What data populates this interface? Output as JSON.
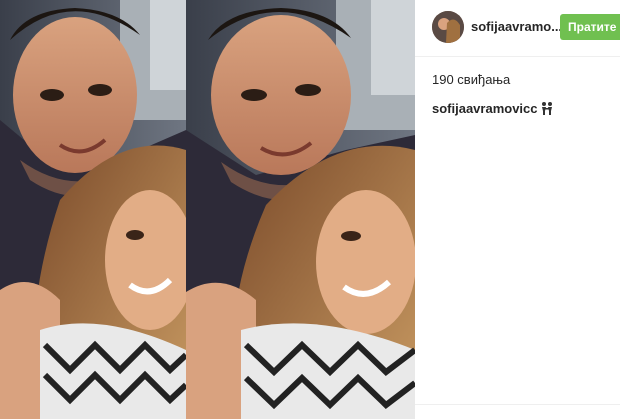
{
  "post": {
    "author": {
      "username_truncated": "sofijaavramo...",
      "avatar_icon": "profile-avatar"
    },
    "follow_label": "Пратите",
    "likes": "190 свиђања",
    "caption": {
      "author": "sofijaavramovicc",
      "emoji_icon": "couple-holding-hands-icon"
    },
    "image": {
      "description_icon": "selfie-photo"
    }
  },
  "colors": {
    "follow_button": "#70c050",
    "text": "#262626",
    "divider": "#efefef"
  }
}
